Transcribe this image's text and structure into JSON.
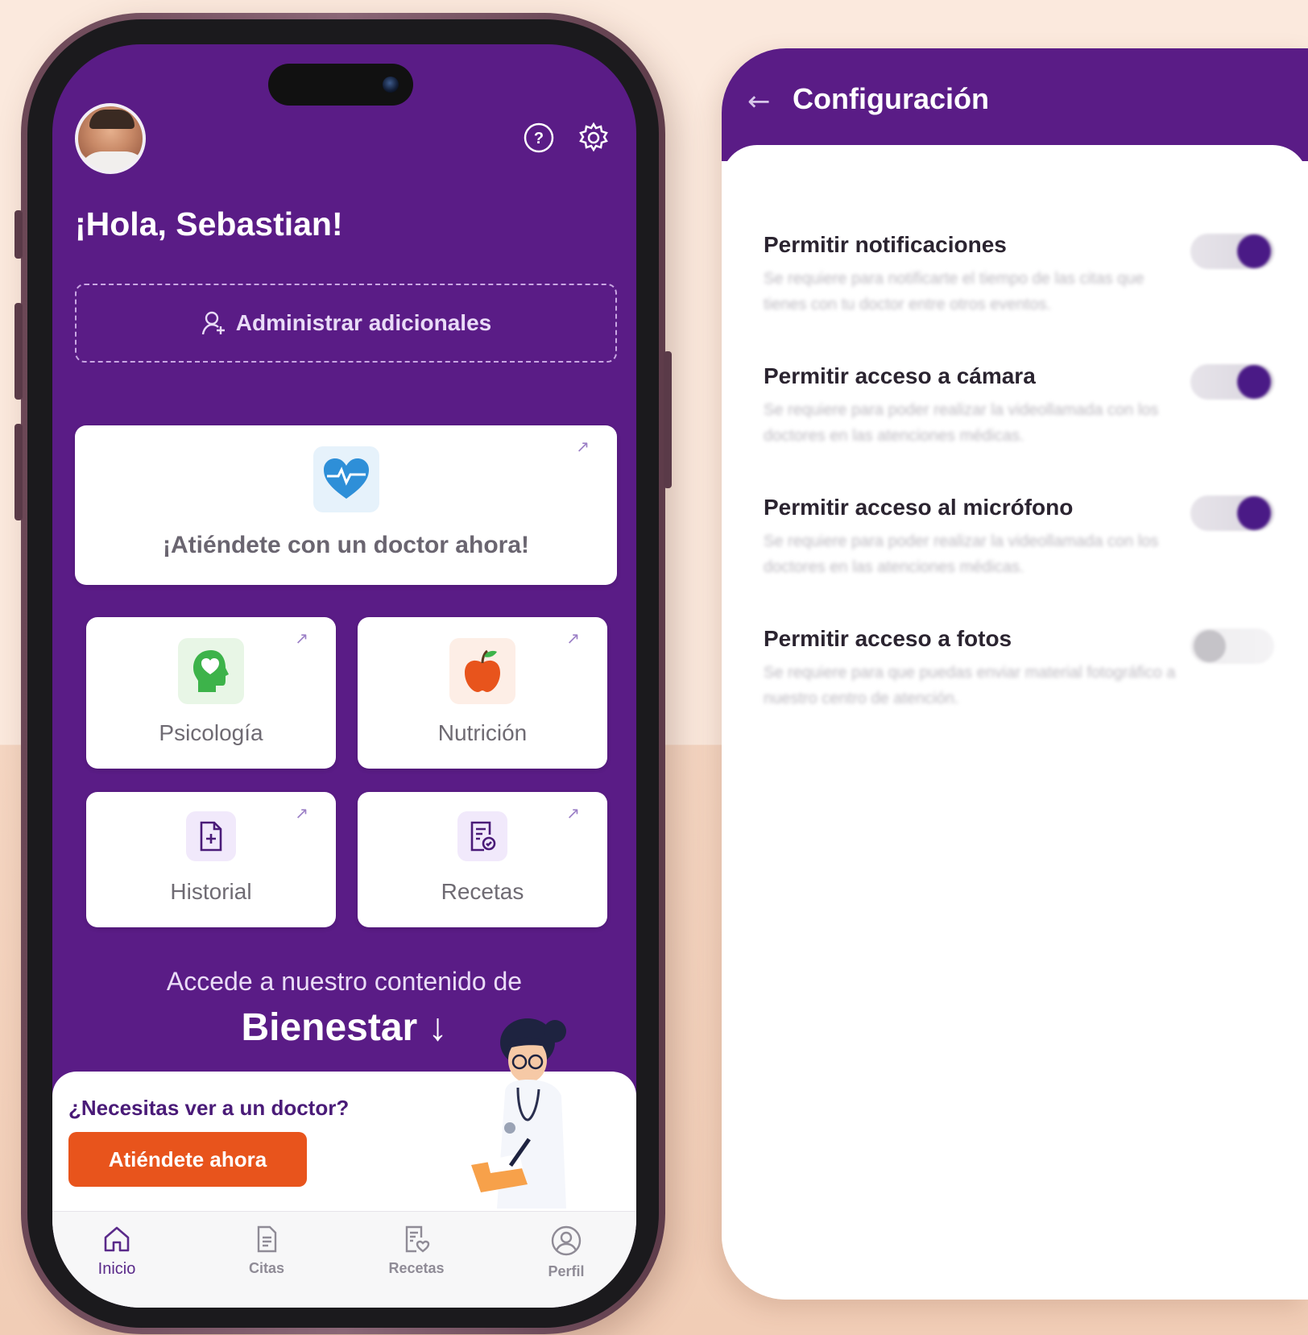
{
  "phone": {
    "greeting": "¡Hola, Sebastian!",
    "admin_label": "Administrar adicionales",
    "doctor_card_label": "¡Atiéndete con un doctor ahora!",
    "services": [
      {
        "label": "Psicología",
        "icon": "brain-heart-icon"
      },
      {
        "label": "Nutrición",
        "icon": "apple-icon"
      },
      {
        "label": "Historial",
        "icon": "medical-file-icon"
      },
      {
        "label": "Recetas",
        "icon": "prescription-icon"
      }
    ],
    "wellness": {
      "subtitle": "Accede a nuestro contenido de",
      "title": "Bienestar ↓"
    },
    "promo": {
      "question": "¿Necesitas ver a un doctor?",
      "button": "Atiéndete ahora"
    },
    "tabs": [
      {
        "label": "Inicio",
        "icon": "home-icon",
        "active": true
      },
      {
        "label": "Citas",
        "icon": "document-icon",
        "active": false
      },
      {
        "label": "Recetas",
        "icon": "prescription-heart-icon",
        "active": false
      },
      {
        "label": "Perfil",
        "icon": "user-circle-icon",
        "active": false
      }
    ]
  },
  "config": {
    "title": "Configuración",
    "permissions": [
      {
        "title": "Permitir notificaciones",
        "desc": "Se requiere para notificarte el tiempo de las citas que tienes con tu doctor entre otros eventos.",
        "enabled": true
      },
      {
        "title": "Permitir acceso a cámara",
        "desc": "Se requiere para poder realizar la videollamada con los doctores en las atenciones médicas.",
        "enabled": true
      },
      {
        "title": "Permitir acceso al micrófono",
        "desc": "Se requiere para poder realizar la videollamada con los doctores en las atenciones médicas.",
        "enabled": true
      },
      {
        "title": "Permitir acceso a fotos",
        "desc": "Se requiere para que puedas enviar material fotográfico a nuestro centro de atención.",
        "enabled": false
      }
    ]
  },
  "colors": {
    "brand_purple": "#5a1c86",
    "accent_orange": "#e8541c",
    "background_peach": "#fbe9dd"
  }
}
